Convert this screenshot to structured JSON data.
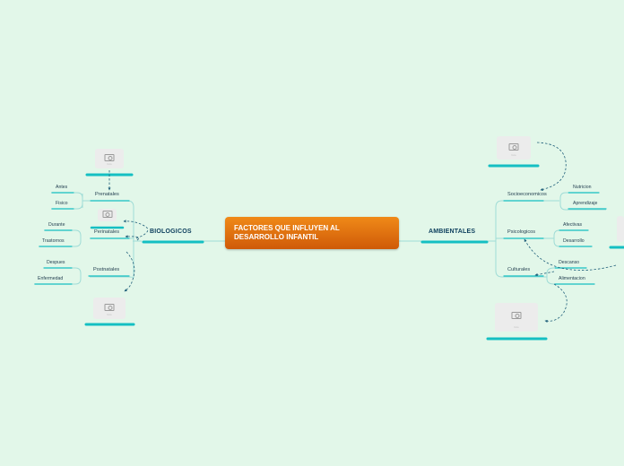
{
  "central": {
    "title": "FACTORES QUE INFLUYEN AL\nDESARROLLO INFANTIL"
  },
  "colors": {
    "line": "#9fdcd6",
    "bar": "#14bfc2",
    "central": "#e0700f",
    "dash": "#1f5f7a"
  },
  "left": {
    "label": "BIOLOGICOS",
    "subs": [
      {
        "label": "Prenatales",
        "leaves": [
          "Antes",
          "Fisico"
        ]
      },
      {
        "label": "Perinatales",
        "leaves": [
          "Durante",
          "Trastornos"
        ]
      },
      {
        "label": "Postnatales",
        "leaves": [
          "Despues",
          "Enfermedad"
        ]
      }
    ]
  },
  "right": {
    "label": "AMBIENTALES",
    "subs": [
      {
        "label": "Socioeconomicos",
        "leaves": [
          "Nutricion",
          "Aprendizaje"
        ]
      },
      {
        "label": "Psicologicos",
        "leaves": [
          "Afectivas",
          "Desarrollo"
        ]
      },
      {
        "label": "Culturales",
        "leaves": [
          "Descanso",
          "Alimentacion"
        ]
      }
    ]
  },
  "images": [
    {
      "name": "image-placeholder-prenatales",
      "icon": "camera-icon",
      "caption": "foto"
    },
    {
      "name": "image-placeholder-perinatales",
      "icon": "image-icon",
      "caption": ""
    },
    {
      "name": "image-placeholder-postnatales",
      "icon": "camera-icon",
      "caption": "foto"
    },
    {
      "name": "image-placeholder-socioeconomicos",
      "icon": "camera-icon",
      "caption": "foto"
    },
    {
      "name": "image-placeholder-psicologicos",
      "icon": "camera-icon",
      "caption": ""
    },
    {
      "name": "image-placeholder-culturales",
      "icon": "camera-icon",
      "caption": "foto"
    }
  ]
}
